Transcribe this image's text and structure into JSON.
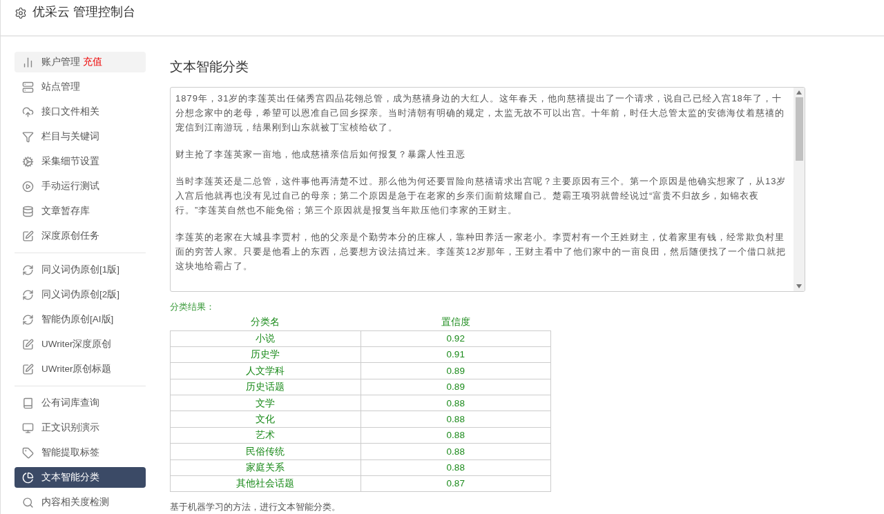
{
  "header": {
    "title": "优采云 管理控制台"
  },
  "sidebar": {
    "groups": [
      {
        "items": [
          {
            "label": "账户管理",
            "badge": "充值",
            "hovered": true,
            "selected": false
          },
          {
            "label": "站点管理",
            "hovered": false,
            "selected": false
          },
          {
            "label": "接口文件相关",
            "hovered": false,
            "selected": false
          },
          {
            "label": "栏目与关键词",
            "hovered": false,
            "selected": false
          },
          {
            "label": "采集细节设置",
            "hovered": false,
            "selected": false
          },
          {
            "label": "手动运行测试",
            "hovered": false,
            "selected": false
          },
          {
            "label": "文章暂存库",
            "hovered": false,
            "selected": false
          },
          {
            "label": "深度原创任务",
            "hovered": false,
            "selected": false
          }
        ]
      },
      {
        "items": [
          {
            "label": "同义词伪原创[1版]",
            "hovered": false,
            "selected": false
          },
          {
            "label": "同义词伪原创[2版]",
            "hovered": false,
            "selected": false
          },
          {
            "label": "智能伪原创[AI版]",
            "hovered": false,
            "selected": false
          },
          {
            "label": "UWriter深度原创",
            "hovered": false,
            "selected": false
          },
          {
            "label": "UWriter原创标题",
            "hovered": false,
            "selected": false
          }
        ]
      },
      {
        "items": [
          {
            "label": "公有词库查询",
            "hovered": false,
            "selected": false
          },
          {
            "label": "正文识别演示",
            "hovered": false,
            "selected": false
          },
          {
            "label": "智能提取标签",
            "hovered": false,
            "selected": false
          },
          {
            "label": "文本智能分类",
            "hovered": false,
            "selected": true
          },
          {
            "label": "内容相关度检测",
            "hovered": false,
            "selected": false
          }
        ]
      }
    ]
  },
  "main": {
    "title": "文本智能分类",
    "text_input": {
      "paragraphs": [
        "1879年，31岁的李莲英出任储秀宫四品花翎总管，成为慈禧身边的大红人。这年春天，他向慈禧提出了一个请求，说自己已经入宫18年了，十分想念家中的老母，希望可以恩准自己回乡探亲。当时清朝有明确的规定，太监无故不可以出宫。十年前，时任大总管太监的安德海仗着慈禧的宠信到江南游玩，结果刚到山东就被丁宝桢给砍了。",
        "财主抢了李莲英家一亩地，他成慈禧亲信后如何报复？暴露人性丑恶",
        "当时李莲英还是二总管，这件事他再清楚不过。那么他为何还要冒险向慈禧请求出宫呢？主要原因有三个。第一个原因是他确实想家了，从13岁入宫后他就再也没有见过自己的母亲；第二个原因是急于在老家的乡亲们面前炫耀自己。楚霸王项羽就曾经说过“富贵不归故乡，如锦衣夜行。”李莲英自然也不能免俗；第三个原因就是报复当年欺压他们李家的王财主。",
        "李莲英的老家在大城县李贾村，他的父亲是个勤劳本分的庄稼人，靠种田养活一家老小。李贾村有一个王姓财主，仗着家里有钱，经常欺负村里面的穷苦人家。只要是他看上的东西，总要想方设法搞过来。李莲英12岁那年，王财主看中了他们家中的一亩良田，然后随便找了一个借口就把这块地给霸占了。"
      ]
    },
    "result_label": "分类结果：",
    "table": {
      "columns": [
        "分类名",
        "置信度"
      ],
      "rows": [
        [
          "小说",
          "0.92"
        ],
        [
          "历史学",
          "0.91"
        ],
        [
          "人文学科",
          "0.89"
        ],
        [
          "历史话题",
          "0.89"
        ],
        [
          "文学",
          "0.88"
        ],
        [
          "文化",
          "0.88"
        ],
        [
          "艺术",
          "0.88"
        ],
        [
          "民俗传统",
          "0.88"
        ],
        [
          "家庭关系",
          "0.88"
        ],
        [
          "其他社会话题",
          "0.87"
        ]
      ]
    },
    "note": "基于机器学习的方法，进行文本智能分类。"
  }
}
